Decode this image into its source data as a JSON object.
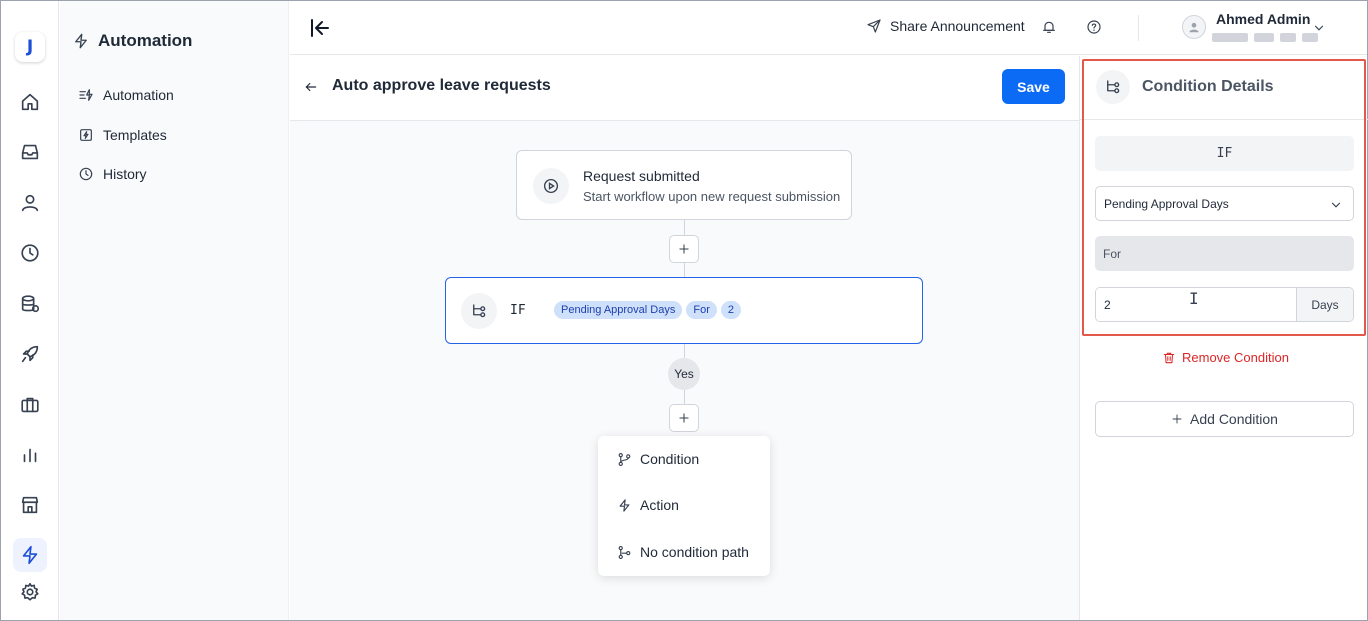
{
  "rail": {
    "logo": "J",
    "items": [
      "home-icon",
      "inbox-icon",
      "user-icon",
      "clock-icon",
      "database-icon",
      "rocket-icon",
      "briefcase-icon",
      "bar-chart-icon",
      "store-icon",
      "lightning-icon",
      "gear-icon"
    ],
    "active": "lightning-icon"
  },
  "sidebar": {
    "title": "Automation",
    "items": [
      {
        "label": "Automation",
        "icon": "list-lightning-icon"
      },
      {
        "label": "Templates",
        "icon": "template-lightning-icon"
      },
      {
        "label": "History",
        "icon": "history-icon"
      }
    ]
  },
  "topbar": {
    "share_label": "Share Announcement",
    "user_name": "Ahmed Admin"
  },
  "content": {
    "title": "Auto approve leave requests",
    "save_label": "Save"
  },
  "flow": {
    "trigger": {
      "title": "Request submitted",
      "subtitle": "Start workflow upon new request submission"
    },
    "if_node": {
      "label": "IF",
      "chips": [
        "Pending Approval Days",
        "For",
        "2"
      ]
    },
    "yes_label": "Yes",
    "menu": [
      "Condition",
      "Action",
      "No condition path"
    ]
  },
  "panel": {
    "title": "Condition Details",
    "if_label": "IF",
    "field_value": "Pending Approval Days",
    "operator_value": "For",
    "days_value": "2",
    "days_unit": "Days",
    "remove_label": "Remove Condition",
    "add_label": "Add Condition"
  },
  "colors": {
    "accent": "#0b6bf5",
    "danger": "#dc2626",
    "highlight": "#e4574b",
    "chip_bg": "#cfe0fb"
  }
}
